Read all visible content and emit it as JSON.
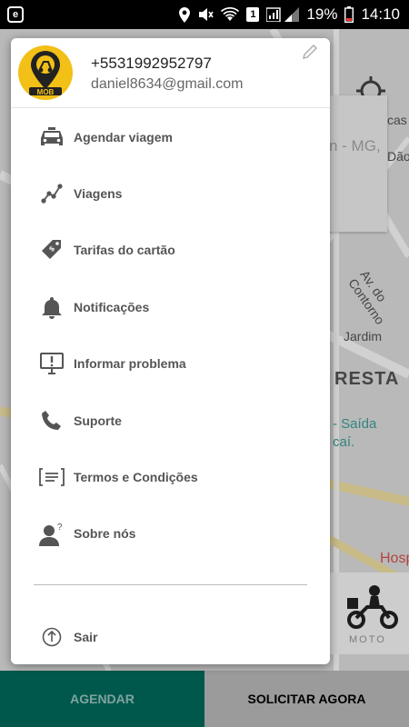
{
  "status_bar": {
    "badge": "1",
    "battery": "19%",
    "time": "14:10"
  },
  "map": {
    "labels": {
      "street": "Av. do Contorno",
      "district": "RESTA",
      "jardim": "Jardim",
      "cas": "cas",
      "dao": "Dão",
      "saida": "- Saída",
      "caí": "caí.",
      "mg": "n - MG,",
      "hosp": "Hosp"
    },
    "moto_label": "MOTO"
  },
  "drawer": {
    "phone": "+5531992952797",
    "email": "daniel8634@gmail.com",
    "logo_text": "MOB",
    "items": [
      {
        "label": "Agendar viagem",
        "icon": "car-icon"
      },
      {
        "label": "Viagens",
        "icon": "route-icon"
      },
      {
        "label": "Tarifas do cartão",
        "icon": "price-tag-icon"
      },
      {
        "label": "Notificações",
        "icon": "bell-icon"
      },
      {
        "label": "Informar problema",
        "icon": "report-problem-icon"
      },
      {
        "label": "Suporte",
        "icon": "phone-icon"
      },
      {
        "label": "Termos e Condições",
        "icon": "terms-icon"
      },
      {
        "label": "Sobre nós",
        "icon": "about-icon"
      }
    ],
    "logout": "Sair"
  },
  "bottom_bar": {
    "schedule_label": "AGENDAR",
    "request_label": "SOLICITAR AGORA"
  },
  "colors": {
    "accent": "#016c5f",
    "logo_yellow": "#f2c016"
  }
}
